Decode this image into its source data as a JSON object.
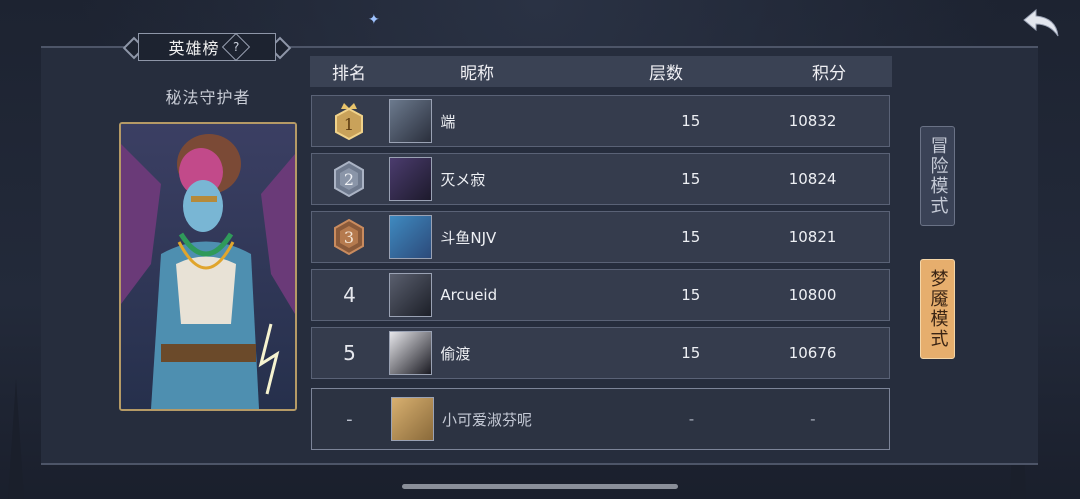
{
  "title": "英雄榜",
  "help_icon": "?",
  "hero_name": "秘法守护者",
  "columns": {
    "rank": "排名",
    "nickname": "昵称",
    "floors": "层数",
    "score": "积分"
  },
  "rows": [
    {
      "rank": "1",
      "nickname": "端",
      "floors": "15",
      "score": "10832"
    },
    {
      "rank": "2",
      "nickname": "灭メ寂",
      "floors": "15",
      "score": "10824"
    },
    {
      "rank": "3",
      "nickname": "斗鱼NJV",
      "floors": "15",
      "score": "10821"
    },
    {
      "rank": "4",
      "nickname": "Arcueid",
      "floors": "15",
      "score": "10800"
    },
    {
      "rank": "5",
      "nickname": "偷渡",
      "floors": "15",
      "score": "10676"
    }
  ],
  "self_row": {
    "rank": "-",
    "nickname": "小可爱淑芬呢",
    "floors": "-",
    "score": "-"
  },
  "modes": {
    "adventure": "冒险模式",
    "nightmare": "梦魇模式"
  },
  "colors": {
    "gold": "#d9b36a",
    "silver": "#9aa4b6",
    "bronze": "#c98b5e",
    "active_mode": "#e6ae6d"
  }
}
